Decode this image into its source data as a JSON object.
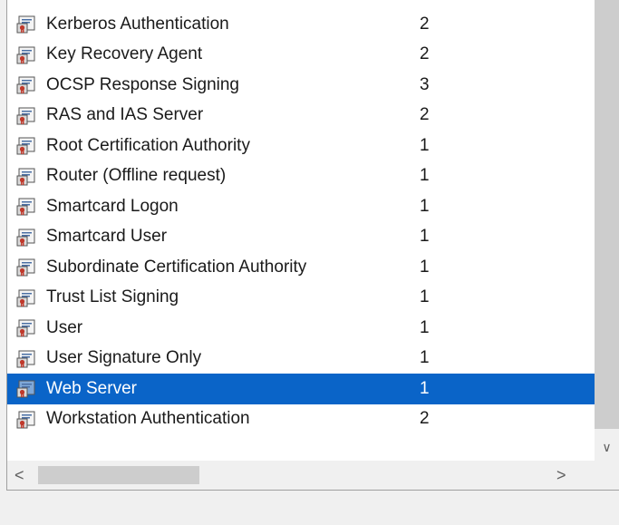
{
  "templates": [
    {
      "name": "Kerberos Authentication",
      "count": "2",
      "selected": false
    },
    {
      "name": "Key Recovery Agent",
      "count": "2",
      "selected": false
    },
    {
      "name": "OCSP Response Signing",
      "count": "3",
      "selected": false
    },
    {
      "name": "RAS and IAS Server",
      "count": "2",
      "selected": false
    },
    {
      "name": "Root Certification Authority",
      "count": "1",
      "selected": false
    },
    {
      "name": "Router (Offline request)",
      "count": "1",
      "selected": false
    },
    {
      "name": "Smartcard Logon",
      "count": "1",
      "selected": false
    },
    {
      "name": "Smartcard User",
      "count": "1",
      "selected": false
    },
    {
      "name": "Subordinate Certification Authority",
      "count": "1",
      "selected": false
    },
    {
      "name": "Trust List Signing",
      "count": "1",
      "selected": false
    },
    {
      "name": "User",
      "count": "1",
      "selected": false
    },
    {
      "name": "User Signature Only",
      "count": "1",
      "selected": false
    },
    {
      "name": "Web Server",
      "count": "1",
      "selected": true
    },
    {
      "name": "Workstation Authentication",
      "count": "2",
      "selected": false
    }
  ],
  "icons": {
    "row": "certificate-template-icon"
  },
  "colors": {
    "selection": "#0a64c8",
    "scrollbar_thumb": "#cdcdcd",
    "background": "#f0f0f0"
  }
}
